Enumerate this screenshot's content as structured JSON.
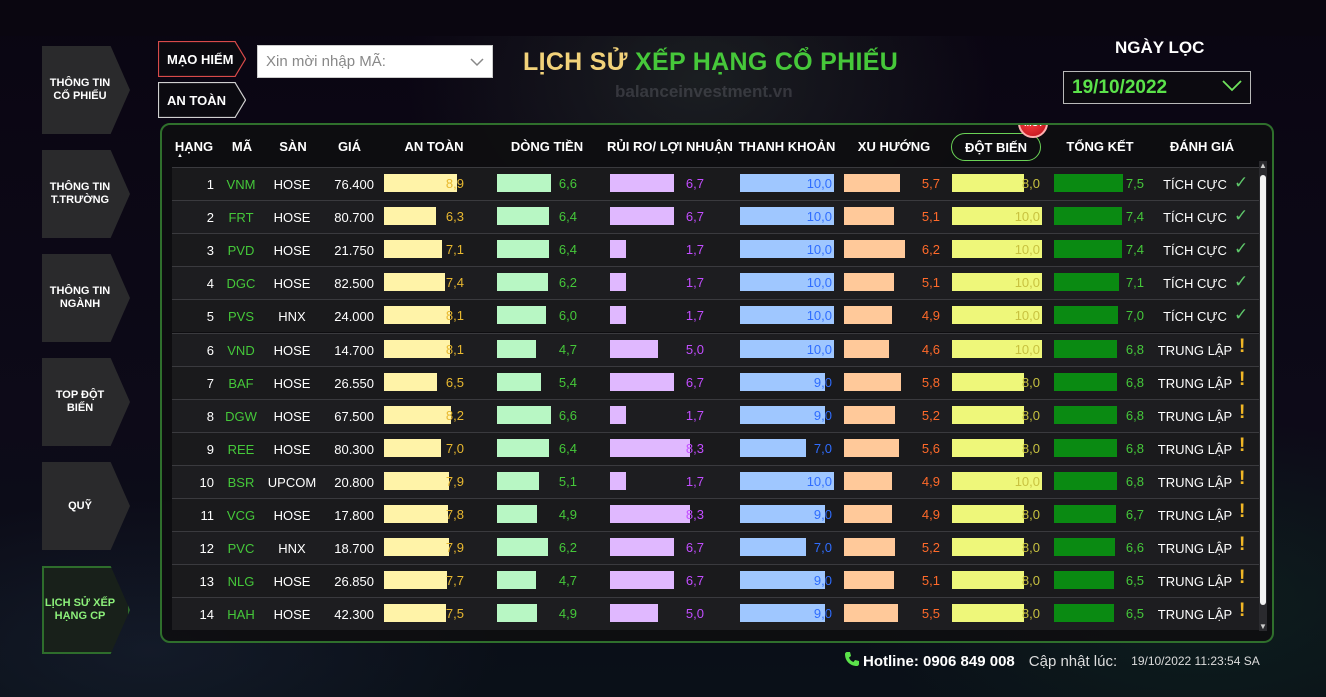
{
  "sidebar": {
    "items": [
      {
        "label": "THÔNG TIN\nCỔ PHIẾU",
        "active": false
      },
      {
        "label": "THÔNG TIN\nT.TRƯỜNG",
        "active": false
      },
      {
        "label": "THÔNG TIN\nNGÀNH",
        "active": false
      },
      {
        "label": "TOP ĐỘT\nBIẾN",
        "active": false
      },
      {
        "label": "QUỸ",
        "active": false
      },
      {
        "label": "LỊCH SỬ XẾP\nHẠNG CP",
        "active": true
      }
    ]
  },
  "filters": {
    "risky_label": "MẠO HIỂM",
    "safe_label": "AN TOÀN",
    "search_placeholder": "Xin mời nhập MÃ:"
  },
  "header": {
    "title_part1": "LỊCH SỬ",
    "title_part2": "XẾP HẠNG CỔ PHIẾU",
    "watermark": "balanceinvestment.vn"
  },
  "date_filter": {
    "label": "NGÀY LỌC",
    "value": "19/10/2022"
  },
  "table": {
    "columns": [
      "HẠNG",
      "MÃ",
      "SÀN",
      "GIÁ",
      "AN TOÀN",
      "DÒNG TIỀN",
      "RỦI RO/ LỢI NHUẬN",
      "THANH KHOẢN",
      "XU HƯỚNG",
      "ĐỘT BIẾN",
      "TỔNG KẾT",
      "ĐÁNH GIÁ"
    ],
    "new_badge": "MỚI",
    "colors": {
      "an_toan": "#fff3a8",
      "dong_tien": "#b8f7c4",
      "rui_ro": "#e0b8ff",
      "thanh_khoan": "#9fc7ff",
      "xu_huong": "#ffc99a",
      "dot_bien": "#eef77a",
      "tong_ket": "#0a8a12",
      "an_toan_text": "#e8b830",
      "dong_tien_text": "#45c83a",
      "rui_ro_text": "#c24dff",
      "thanh_khoan_text": "#2f6dff",
      "xu_huong_text": "#ff6a2a",
      "dot_bien_text": "#c8c240",
      "tong_ket_text": "#45c83a"
    },
    "rows": [
      {
        "rank": "1",
        "code": "VNM",
        "exchange": "HOSE",
        "price": "76.400",
        "an_toan": "8,9",
        "dong_tien": "6,6",
        "rui_ro": "6,7",
        "thanh_khoan": "10,0",
        "xu_huong": "5,7",
        "dot_bien": "8,0",
        "tong_ket": "7,5",
        "rating": "TÍCH CỰC",
        "icon": "check-icon"
      },
      {
        "rank": "2",
        "code": "FRT",
        "exchange": "HOSE",
        "price": "80.700",
        "an_toan": "6,3",
        "dong_tien": "6,4",
        "rui_ro": "6,7",
        "thanh_khoan": "10,0",
        "xu_huong": "5,1",
        "dot_bien": "10,0",
        "tong_ket": "7,4",
        "rating": "TÍCH CỰC",
        "icon": "check-icon"
      },
      {
        "rank": "3",
        "code": "PVD",
        "exchange": "HOSE",
        "price": "21.750",
        "an_toan": "7,1",
        "dong_tien": "6,4",
        "rui_ro": "1,7",
        "thanh_khoan": "10,0",
        "xu_huong": "6,2",
        "dot_bien": "10,0",
        "tong_ket": "7,4",
        "rating": "TÍCH CỰC",
        "icon": "check-icon"
      },
      {
        "rank": "4",
        "code": "DGC",
        "exchange": "HOSE",
        "price": "82.500",
        "an_toan": "7,4",
        "dong_tien": "6,2",
        "rui_ro": "1,7",
        "thanh_khoan": "10,0",
        "xu_huong": "5,1",
        "dot_bien": "10,0",
        "tong_ket": "7,1",
        "rating": "TÍCH CỰC",
        "icon": "check-icon"
      },
      {
        "rank": "5",
        "code": "PVS",
        "exchange": "HNX",
        "price": "24.000",
        "an_toan": "8,1",
        "dong_tien": "6,0",
        "rui_ro": "1,7",
        "thanh_khoan": "10,0",
        "xu_huong": "4,9",
        "dot_bien": "10,0",
        "tong_ket": "7,0",
        "rating": "TÍCH CỰC",
        "icon": "check-icon"
      },
      {
        "rank": "6",
        "code": "VND",
        "exchange": "HOSE",
        "price": "14.700",
        "an_toan": "8,1",
        "dong_tien": "4,7",
        "rui_ro": "5,0",
        "thanh_khoan": "10,0",
        "xu_huong": "4,6",
        "dot_bien": "10,0",
        "tong_ket": "6,8",
        "rating": "TRUNG LẬP",
        "icon": "warning-icon"
      },
      {
        "rank": "7",
        "code": "BAF",
        "exchange": "HOSE",
        "price": "26.550",
        "an_toan": "6,5",
        "dong_tien": "5,4",
        "rui_ro": "6,7",
        "thanh_khoan": "9,0",
        "xu_huong": "5,8",
        "dot_bien": "8,0",
        "tong_ket": "6,8",
        "rating": "TRUNG LẬP",
        "icon": "warning-icon"
      },
      {
        "rank": "8",
        "code": "DGW",
        "exchange": "HOSE",
        "price": "67.500",
        "an_toan": "8,2",
        "dong_tien": "6,6",
        "rui_ro": "1,7",
        "thanh_khoan": "9,0",
        "xu_huong": "5,2",
        "dot_bien": "8,0",
        "tong_ket": "6,8",
        "rating": "TRUNG LẬP",
        "icon": "warning-icon"
      },
      {
        "rank": "9",
        "code": "REE",
        "exchange": "HOSE",
        "price": "80.300",
        "an_toan": "7,0",
        "dong_tien": "6,4",
        "rui_ro": "8,3",
        "thanh_khoan": "7,0",
        "xu_huong": "5,6",
        "dot_bien": "8,0",
        "tong_ket": "6,8",
        "rating": "TRUNG LẬP",
        "icon": "warning-icon"
      },
      {
        "rank": "10",
        "code": "BSR",
        "exchange": "UPCOM",
        "price": "20.800",
        "an_toan": "7,9",
        "dong_tien": "5,1",
        "rui_ro": "1,7",
        "thanh_khoan": "10,0",
        "xu_huong": "4,9",
        "dot_bien": "10,0",
        "tong_ket": "6,8",
        "rating": "TRUNG LẬP",
        "icon": "warning-icon"
      },
      {
        "rank": "11",
        "code": "VCG",
        "exchange": "HOSE",
        "price": "17.800",
        "an_toan": "7,8",
        "dong_tien": "4,9",
        "rui_ro": "8,3",
        "thanh_khoan": "9,0",
        "xu_huong": "4,9",
        "dot_bien": "8,0",
        "tong_ket": "6,7",
        "rating": "TRUNG LẬP",
        "icon": "warning-icon"
      },
      {
        "rank": "12",
        "code": "PVC",
        "exchange": "HNX",
        "price": "18.700",
        "an_toan": "7,9",
        "dong_tien": "6,2",
        "rui_ro": "6,7",
        "thanh_khoan": "7,0",
        "xu_huong": "5,2",
        "dot_bien": "8,0",
        "tong_ket": "6,6",
        "rating": "TRUNG LẬP",
        "icon": "warning-icon"
      },
      {
        "rank": "13",
        "code": "NLG",
        "exchange": "HOSE",
        "price": "26.850",
        "an_toan": "7,7",
        "dong_tien": "4,7",
        "rui_ro": "6,7",
        "thanh_khoan": "9,0",
        "xu_huong": "5,1",
        "dot_bien": "8,0",
        "tong_ket": "6,5",
        "rating": "TRUNG LẬP",
        "icon": "warning-icon"
      },
      {
        "rank": "14",
        "code": "HAH",
        "exchange": "HOSE",
        "price": "42.300",
        "an_toan": "7,5",
        "dong_tien": "4,9",
        "rui_ro": "5,0",
        "thanh_khoan": "9,0",
        "xu_huong": "5,5",
        "dot_bien": "8,0",
        "tong_ket": "6,5",
        "rating": "TRUNG LẬP",
        "icon": "warning-icon"
      }
    ]
  },
  "footer": {
    "hotline": "Hotline: 0906 849 008",
    "updated_label": "Cập nhật lúc:",
    "updated_time": "19/10/2022 11:23:54 SA"
  }
}
